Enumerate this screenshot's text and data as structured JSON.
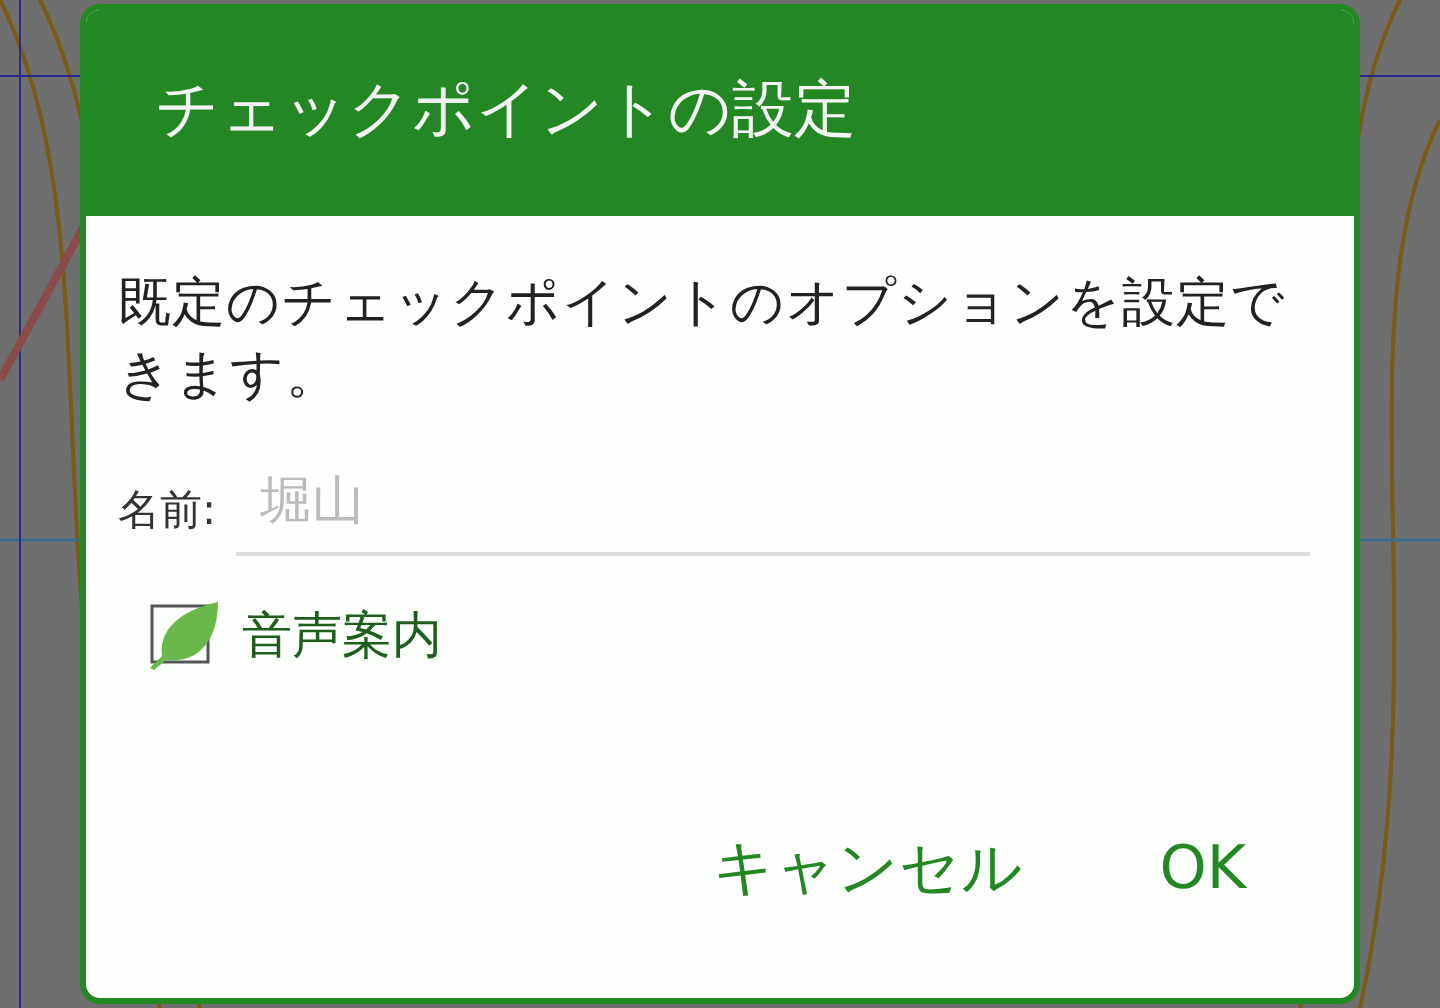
{
  "dialog": {
    "title": "チェックポイントの設定",
    "message": "既定のチェックポイントのオプションを設定できます。",
    "name_label": "名前:",
    "name_field": {
      "placeholder": "堀山"
    },
    "checkbox": {
      "label": "音声案内",
      "checked": true
    },
    "buttons": [
      {
        "label": "キャンセル"
      },
      {
        "label": "OK"
      }
    ]
  }
}
